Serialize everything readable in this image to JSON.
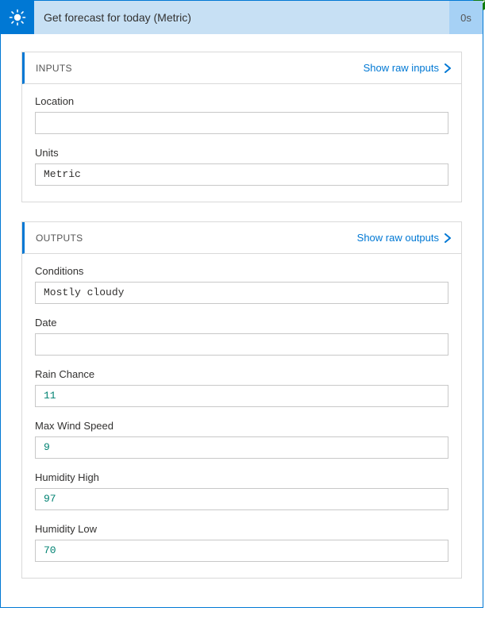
{
  "header": {
    "title": "Get forecast for today (Metric)",
    "duration": "0s"
  },
  "inputs": {
    "section_title": "INPUTS",
    "show_raw_label": "Show raw inputs",
    "fields": {
      "location": {
        "label": "Location",
        "value": ""
      },
      "units": {
        "label": "Units",
        "value": "Metric"
      }
    }
  },
  "outputs": {
    "section_title": "OUTPUTS",
    "show_raw_label": "Show raw outputs",
    "fields": {
      "conditions": {
        "label": "Conditions",
        "value": "Mostly cloudy"
      },
      "date": {
        "label": "Date",
        "value": ""
      },
      "rain_chance": {
        "label": "Rain Chance",
        "value": "11"
      },
      "max_wind_speed": {
        "label": "Max Wind Speed",
        "value": "9"
      },
      "humidity_high": {
        "label": "Humidity High",
        "value": "97"
      },
      "humidity_low": {
        "label": "Humidity Low",
        "value": "70"
      }
    }
  }
}
